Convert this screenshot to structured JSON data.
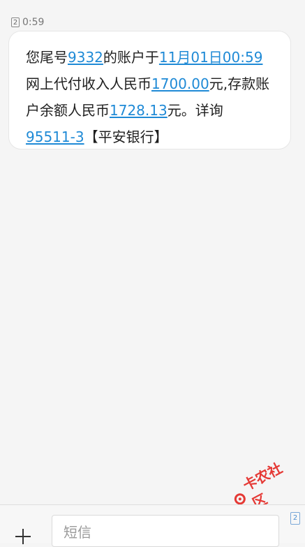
{
  "message": {
    "sim_label": "2",
    "time": "0:59",
    "parts": {
      "p1": "您尾号",
      "account_tail": "9332",
      "p2": "的账户于",
      "datetime": "11月01日00:59",
      "p3": "网上代付收入人民币",
      "amount": "1700.00",
      "p4": "元,存款账户余额人民币",
      "balance": "1728.13",
      "p5": "元。详询",
      "phone": "95511-3",
      "p6": "【平安银行】"
    }
  },
  "composer": {
    "plus_icon": "plus-icon",
    "input_placeholder": "短信",
    "sim_switch_label": "2"
  },
  "watermark": {
    "text": "卡农社区",
    "icon": "logo-icon"
  }
}
